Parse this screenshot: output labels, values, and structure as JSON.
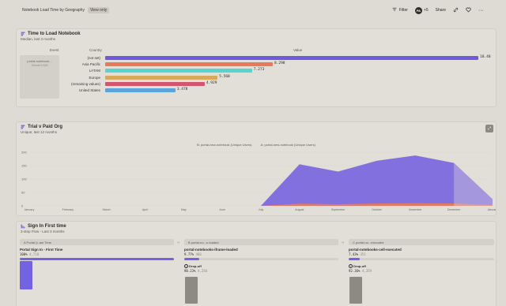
{
  "header": {
    "title": "Notebook Load Time by Geography",
    "view_only": "View only",
    "filter_label": "Filter",
    "avatar_initials": "PA",
    "avatar_count": "+5",
    "share_label": "Share"
  },
  "card1": {
    "title": "Time to Load Notebook",
    "subtitle": "Median, last 3 months",
    "col_event": "Event",
    "col_country": "Country",
    "col_value": "Value",
    "event_name": "portal-notebook...",
    "event_sub": "Overall  5.325",
    "chart_data": {
      "type": "bar",
      "categories": [
        "(not set)",
        "Asia Pacific",
        "LATAM",
        "Europe",
        "(remaining values)",
        "United States"
      ],
      "values": [
        18.48,
        8.298,
        7.273,
        5.568,
        4.929,
        3.478
      ],
      "value_labels": [
        "18.48",
        "8.298",
        "7.273",
        "5.568",
        "4.929",
        "3.478"
      ],
      "colors": [
        "#6e5bd9",
        "#e8795a",
        "#54d6cf",
        "#d9a85a",
        "#d4556e",
        "#5aa3dc"
      ],
      "xlim": [
        0,
        18.48
      ]
    }
  },
  "card2": {
    "title": "Trial v Paid Org",
    "subtitle": "Unique, last 12 months",
    "expand_icon": "expand-icon",
    "chart_data": {
      "type": "area",
      "categories": [
        "January",
        "February",
        "March",
        "April",
        "May",
        "June",
        "July",
        "August",
        "September",
        "October",
        "November",
        "December",
        "January"
      ],
      "yticks": [
        "200",
        "150",
        "100",
        "50",
        "0"
      ],
      "ylim": [
        0,
        200
      ],
      "series": [
        {
          "name": "B: portal-new-notebook (Unique Users)",
          "color": "#7b66e0",
          "values": [
            0,
            0,
            0,
            0,
            0,
            0,
            0,
            155,
            128,
            168,
            188,
            160,
            25
          ]
        },
        {
          "name": "A: portal-new-notebook (Unique Users)",
          "color": "#e8795a",
          "values": [
            0,
            0,
            0,
            0,
            0,
            0,
            0,
            8,
            6,
            9,
            10,
            9,
            3
          ]
        }
      ]
    }
  },
  "card3": {
    "title": "Sign In First time",
    "subtitle": "3-step Flow - Last 3 months",
    "steps": [
      {
        "head": "A Portal (L.ast Time",
        "name": "Portal Sign In - First Time",
        "pct": "100%",
        "count": "4,710",
        "fill": 1.0,
        "bar_height_fraction": 1.0
      },
      {
        "head": "B portal-no...e-loaded",
        "name": "portal-notebooks-iframe-loaded",
        "pct": "9.77%",
        "count": "460",
        "fill": 0.0977,
        "drop_label": "Drop-off",
        "drop_pct": "90.23%",
        "drop_count": "4,250"
      },
      {
        "head": "C portal-no...executed",
        "name": "portal-notebooks-cell-executed",
        "pct": "7.43%",
        "count": "351",
        "fill": 0.0743,
        "drop_label": "Drop-off",
        "drop_pct": "92.36%",
        "drop_count": "4,359"
      }
    ]
  }
}
